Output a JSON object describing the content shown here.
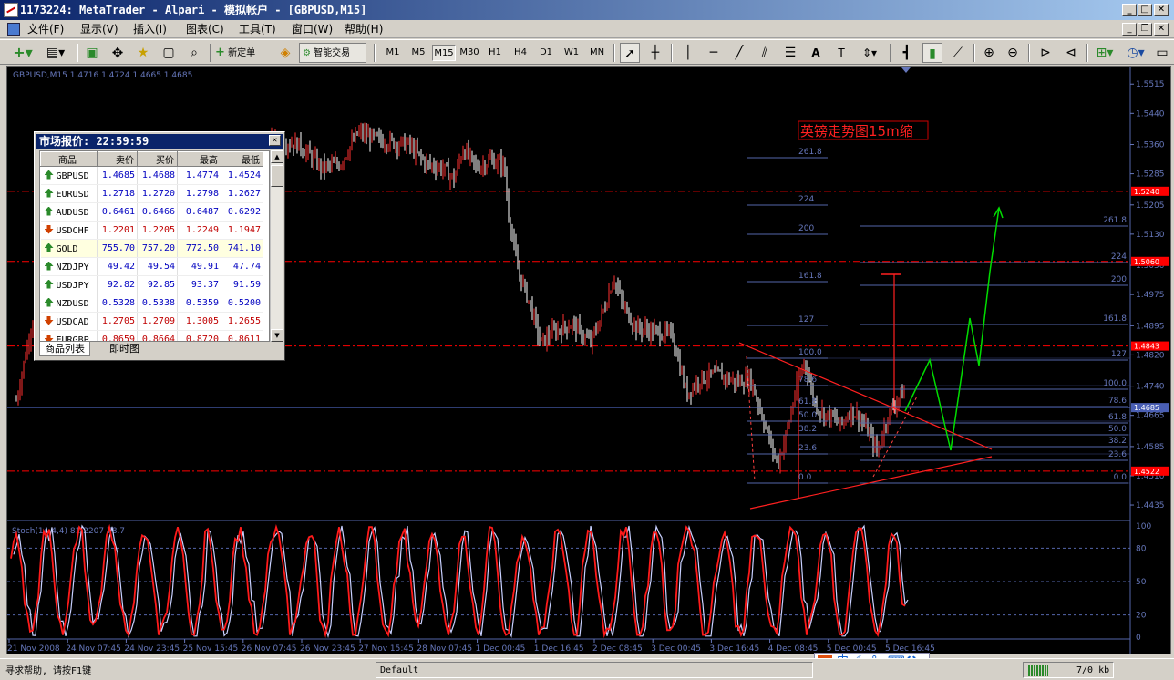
{
  "titlebar": {
    "title": "1173224: MetaTrader - Alpari - 模拟帐户 - [GBPUSD,M15]"
  },
  "menu": [
    "文件(F)",
    "显示(V)",
    "插入(I)",
    "图表(C)",
    "工具(T)",
    "窗口(W)",
    "帮助(H)"
  ],
  "toolbar": {
    "new_order": "新定单",
    "expert": "智能交易",
    "timeframes": [
      "M1",
      "M5",
      "M15",
      "M30",
      "H1",
      "H4",
      "D1",
      "W1",
      "MN"
    ],
    "active_timeframe": "M15"
  },
  "market_watch": {
    "title": "市场报价: 22:59:59",
    "columns": [
      "商品",
      "卖价",
      "买价",
      "最高",
      "最低"
    ],
    "rows": [
      {
        "symbol": "GBPUSD",
        "bid": "1.4685",
        "ask": "1.4688",
        "high": "1.4774",
        "low": "1.4524",
        "dir": "up"
      },
      {
        "symbol": "EURUSD",
        "bid": "1.2718",
        "ask": "1.2720",
        "high": "1.2798",
        "low": "1.2627",
        "dir": "up"
      },
      {
        "symbol": "AUDUSD",
        "bid": "0.6461",
        "ask": "0.6466",
        "high": "0.6487",
        "low": "0.6292",
        "dir": "up"
      },
      {
        "symbol": "USDCHF",
        "bid": "1.2201",
        "ask": "1.2205",
        "high": "1.2249",
        "low": "1.1947",
        "dir": "down"
      },
      {
        "symbol": "GOLD",
        "bid": "755.70",
        "ask": "757.20",
        "high": "772.50",
        "low": "741.10",
        "dir": "up"
      },
      {
        "symbol": "NZDJPY",
        "bid": "49.42",
        "ask": "49.54",
        "high": "49.91",
        "low": "47.74",
        "dir": "up"
      },
      {
        "symbol": "USDJPY",
        "bid": "92.82",
        "ask": "92.85",
        "high": "93.37",
        "low": "91.59",
        "dir": "up"
      },
      {
        "symbol": "NZDUSD",
        "bid": "0.5328",
        "ask": "0.5338",
        "high": "0.5359",
        "low": "0.5200",
        "dir": "up"
      },
      {
        "symbol": "USDCAD",
        "bid": "1.2705",
        "ask": "1.2709",
        "high": "1.3005",
        "low": "1.2655",
        "dir": "down"
      },
      {
        "symbol": "EURGBP",
        "bid": "0.8659",
        "ask": "0.8664",
        "high": "0.8720",
        "low": "0.8611",
        "dir": "down"
      }
    ],
    "tabs": [
      "商品列表",
      "即时图"
    ]
  },
  "chart": {
    "info": "GBPUSD,M15  1.4716 1.4724 1.4665 1.4685",
    "annotation": "英镑走势图15m缩",
    "price_ticks": [
      "1.5515",
      "1.5440",
      "1.5360",
      "1.5285",
      "1.5205",
      "1.5130",
      "1.5050",
      "1.4975",
      "1.4895",
      "1.4820",
      "1.4740",
      "1.4665",
      "1.4585",
      "1.4510",
      "1.4435"
    ],
    "price_markers": [
      {
        "label": "1.5240",
        "color": "#ff0000"
      },
      {
        "label": "1.5060",
        "color": "#ff0000"
      },
      {
        "label": "1.4843",
        "color": "#ff0000"
      },
      {
        "label": "1.4685",
        "color": "#4a5fb4"
      },
      {
        "label": "1.4522",
        "color": "#ff0000"
      }
    ],
    "fib_left": [
      "261.8",
      "224",
      "200",
      "161.8",
      "127",
      "100.0",
      "78.6",
      "61.8",
      "50.0",
      "38.2",
      "23.6",
      "0.0"
    ],
    "fib_right": [
      "261.8",
      "224",
      "200",
      "161.8",
      "127",
      "100.0",
      "78.6",
      "61.8",
      "50.0",
      "38.2",
      "23.6",
      "0.0"
    ],
    "stoch_label": "Stoch(14,4,4) 81.2207 78.7",
    "stoch_ticks": [
      "100",
      "80",
      "50",
      "20",
      "0"
    ],
    "time_ticks": [
      "21 Nov 2008",
      "24 Nov 07:45",
      "24 Nov 23:45",
      "25 Nov 15:45",
      "26 Nov 07:45",
      "26 Nov 23:45",
      "27 Nov 15:45",
      "28 Nov 07:45",
      "1 Dec 00:45",
      "1 Dec 16:45",
      "2 Dec 08:45",
      "3 Dec 00:45",
      "3 Dec 16:45",
      "4 Dec 08:45",
      "5 Dec 00:45",
      "5 Dec 16:45"
    ],
    "colors": {
      "up": "#ff3030",
      "down": "#ffffff",
      "grid_red": "#ff0000",
      "line_blue": "#4a5fb4",
      "forecast": "#00dd00"
    }
  },
  "status": {
    "help": "寻求帮助, 请按F1键",
    "profile": "Default",
    "traffic": "7/0 kb"
  }
}
